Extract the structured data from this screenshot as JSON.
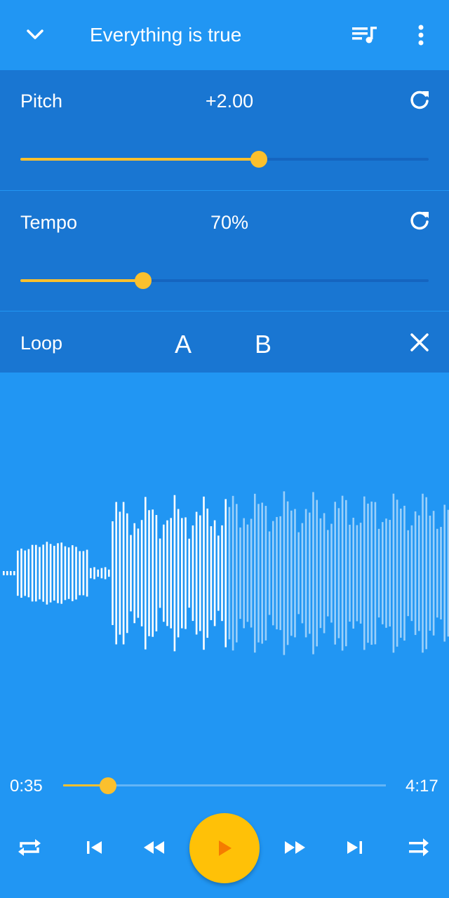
{
  "app_bar": {
    "title": "Everything is true",
    "back_icon": "chevron-down-icon",
    "queue_icon": "playlist-music-icon",
    "more_icon": "more-vert-icon"
  },
  "pitch": {
    "label": "Pitch",
    "value": "+2.00",
    "slider_fraction": 0.585
  },
  "tempo": {
    "label": "Tempo",
    "value": "70%",
    "slider_fraction": 0.3
  },
  "loop": {
    "label": "Loop",
    "a_label": "A",
    "b_label": "B"
  },
  "playback": {
    "elapsed": "0:35",
    "duration": "4:17",
    "progress_fraction": 0.14
  },
  "controls": [
    "repeat-icon",
    "skip-previous-icon",
    "rewind-icon",
    "play-icon",
    "fast-forward-icon",
    "skip-next-icon",
    "shuffle-icon"
  ],
  "colors": {
    "background": "#2196F3",
    "panel": "#1976D2",
    "accent": "#FBC02D",
    "play_button": "#FFC107",
    "play_icon": "#F57C00"
  }
}
